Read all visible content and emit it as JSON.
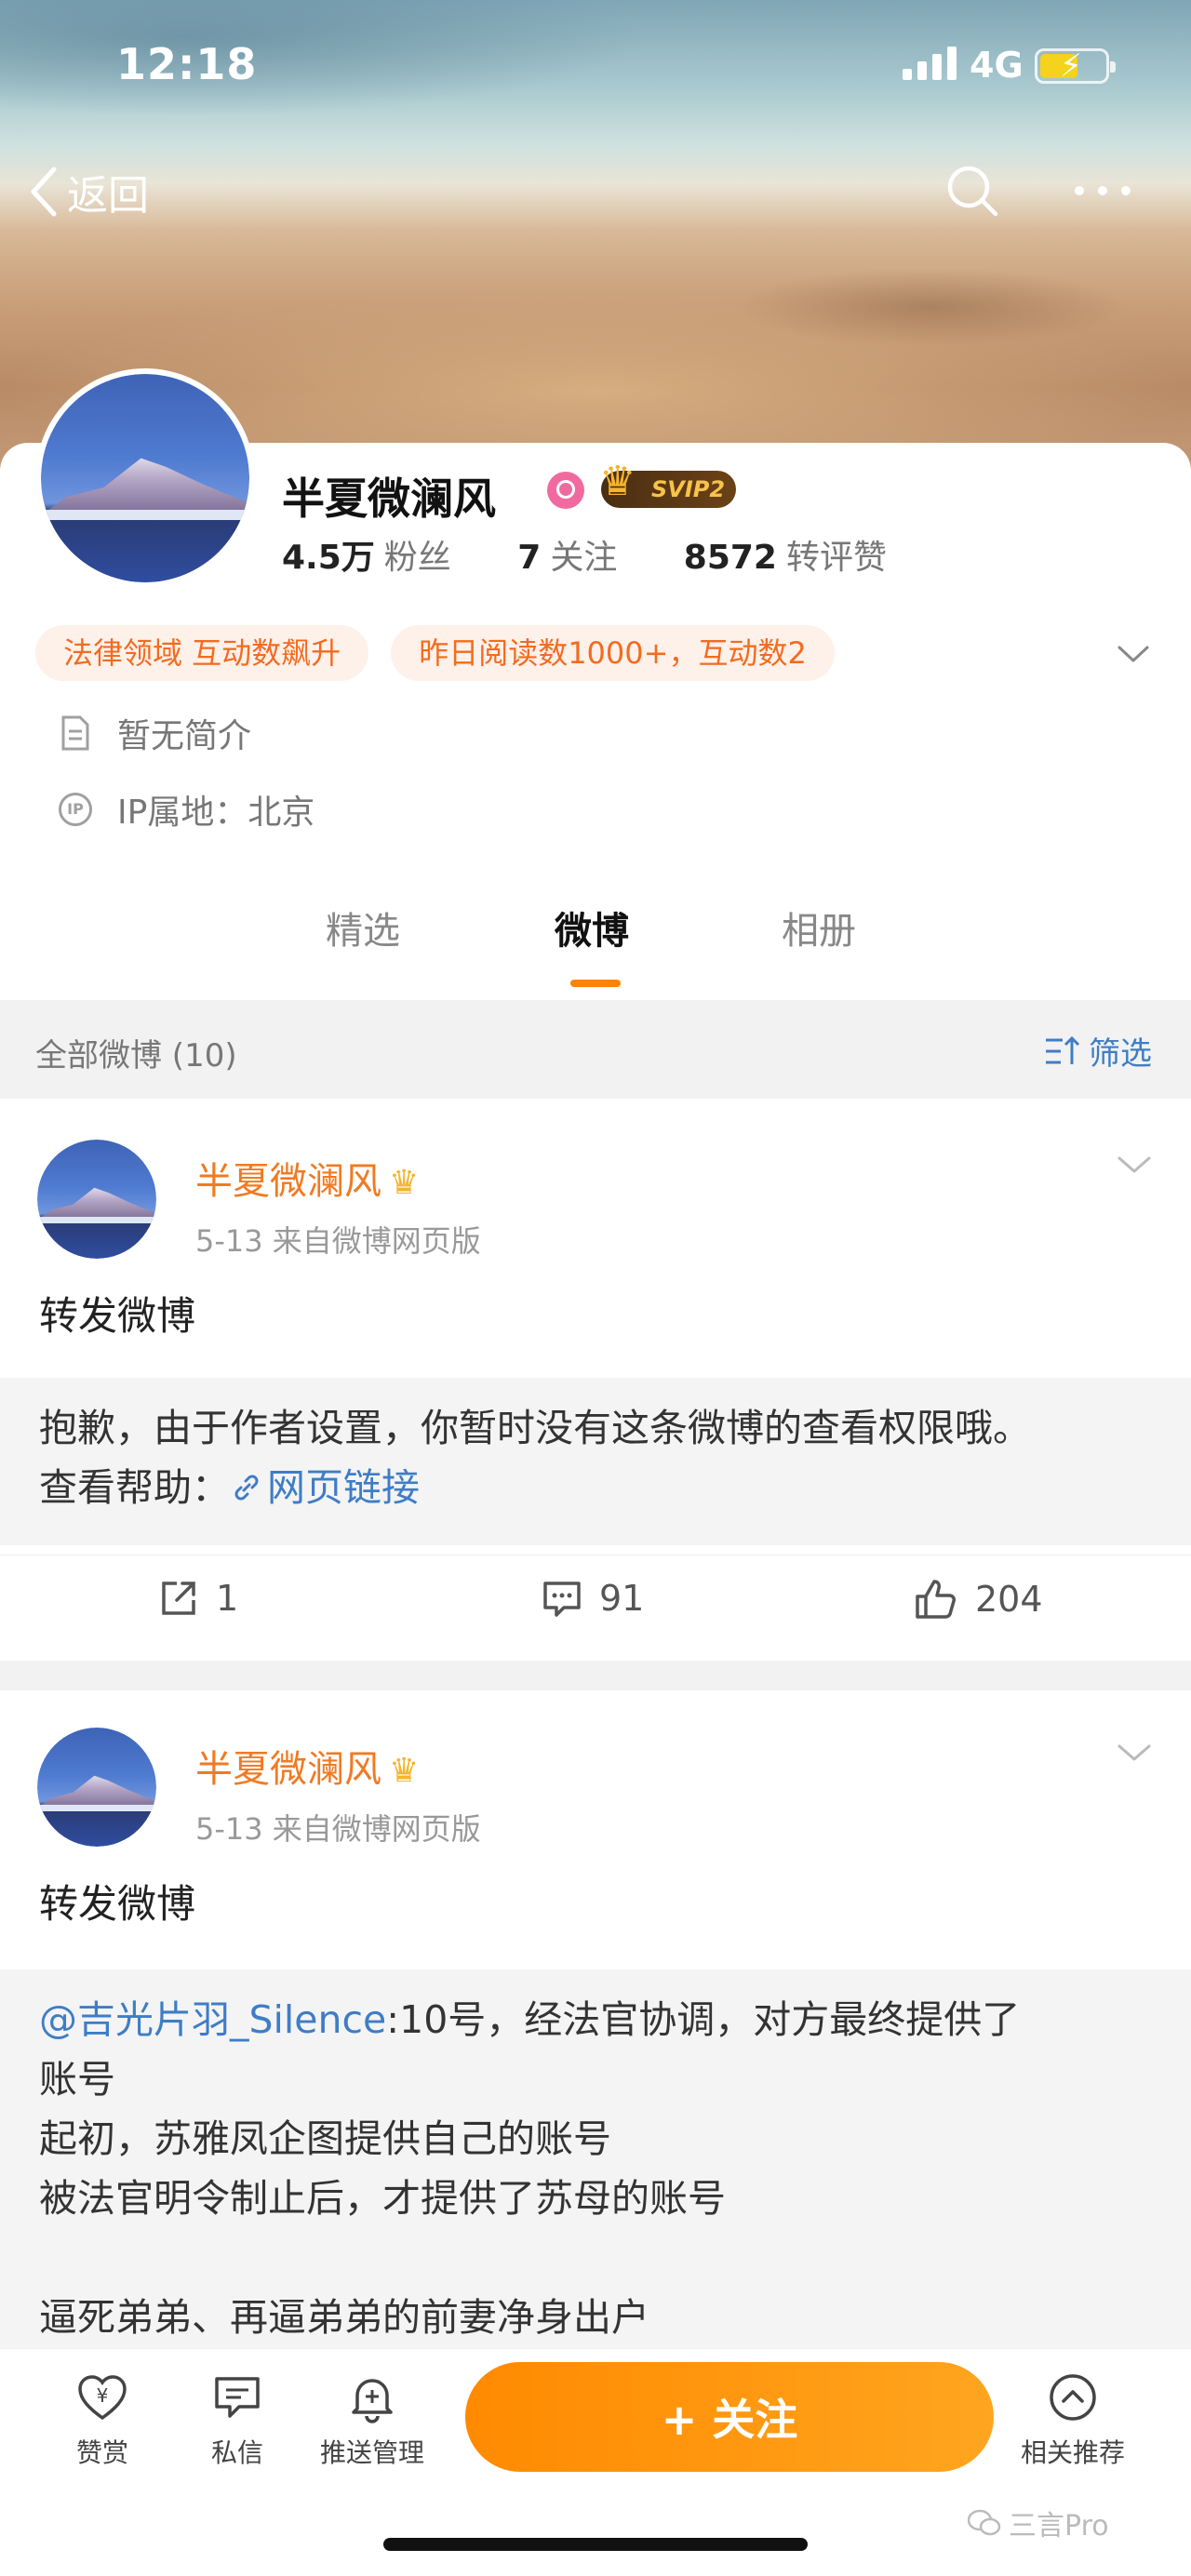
{
  "status": {
    "time": "12:18",
    "network": "4G"
  },
  "nav": {
    "back_label": "返回"
  },
  "profile": {
    "name": "半夏微澜风",
    "vip_badge": "SVIP2",
    "fans_count": "4.5万",
    "fans_label": "粉丝",
    "following_count": "7",
    "following_label": "关注",
    "engagement_count": "8572",
    "engagement_label": "转评赞",
    "tags": [
      "法律领域 互动数飙升",
      "昨日阅读数1000+，互动数2"
    ],
    "bio": "暂无简介",
    "ip_location": "IP属地：北京"
  },
  "tabs": [
    "精选",
    "微博",
    "相册"
  ],
  "active_tab": "微博",
  "feed": {
    "count_label": "全部微博 (10)",
    "filter_label": "筛选"
  },
  "posts": [
    {
      "author": "半夏微澜风",
      "meta": "5-13  来自微博网页版",
      "text": "转发微博",
      "quote_line1": "抱歉，由于作者设置，你暂时没有这条微博的查看权限哦。",
      "quote_help_label": "查看帮助：",
      "quote_link": "网页链接",
      "reposts": "1",
      "comments": "91",
      "likes": "204"
    },
    {
      "author": "半夏微澜风",
      "meta": "5-13  来自微博网页版",
      "text": "转发微博",
      "quote_mention": "@吉光片羽_Silence",
      "quote_lines": [
        ":10号，经法官协调，对方最终提供了",
        "账号",
        "起初，苏雅凤企图提供自己的账号",
        "被法官明令制止后，才提供了苏母的账号",
        "逼死弟弟、再逼弟弟的前妻净身出户"
      ]
    }
  ],
  "bottom_bar": {
    "reward_label": "赞赏",
    "message_label": "私信",
    "push_label": "推送管理",
    "follow_label": "+ 关注",
    "related_label": "相关推荐"
  },
  "watermark": "三言Pro"
}
